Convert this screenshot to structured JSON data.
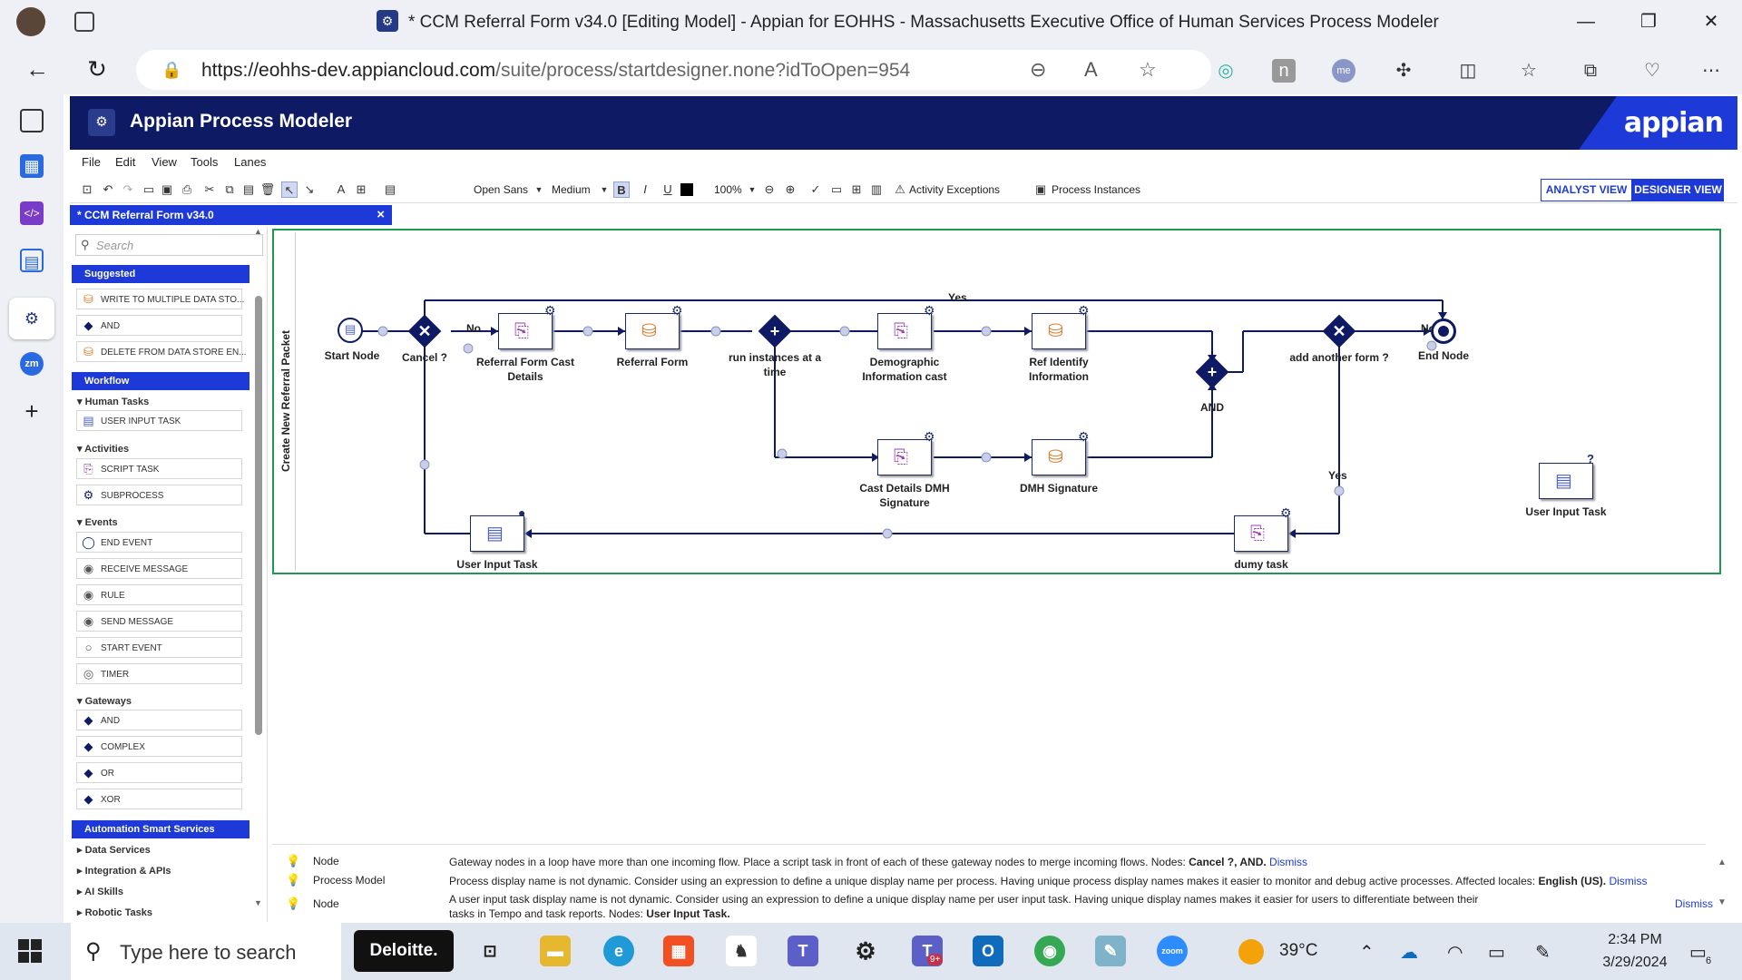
{
  "browser": {
    "window_title": "* CCM Referral Form v34.0 [Editing Model] - Appian for EOHHS - Massachusetts Executive Office of Human Services Process Modeler",
    "url_host": "https://eohhs-dev.appiancloud.com",
    "url_path": "/suite/process/startdesigner.none?idToOpen=954"
  },
  "app": {
    "name": "Appian Process Modeler",
    "brand": "appian"
  },
  "menu": [
    "File",
    "Edit",
    "View",
    "Tools",
    "Lanes"
  ],
  "toolbar": {
    "font": "Open Sans",
    "size": "Medium",
    "zoom": "100%",
    "activity_exceptions": "Activity Exceptions",
    "process_instances": "Process Instances",
    "analyst_view": "ANALYST VIEW",
    "designer_view": "DESIGNER VIEW"
  },
  "tab": {
    "title": "* CCM Referral Form v34.0",
    "close": "×"
  },
  "palette": {
    "search_placeholder": "Search",
    "suggested_title": "Suggested",
    "suggested": [
      "WRITE TO MULTIPLE DATA STO...",
      "AND",
      "DELETE FROM DATA STORE EN..."
    ],
    "workflow_title": "Workflow",
    "human_tasks_title": "Human Tasks",
    "human_tasks": [
      "USER INPUT TASK"
    ],
    "activities_title": "Activities",
    "activities": [
      "SCRIPT TASK",
      "SUBPROCESS"
    ],
    "events_title": "Events",
    "events": [
      "END EVENT",
      "RECEIVE MESSAGE",
      "RULE",
      "SEND MESSAGE",
      "START EVENT",
      "TIMER"
    ],
    "gateways_title": "Gateways",
    "gateways": [
      "AND",
      "COMPLEX",
      "OR",
      "XOR"
    ],
    "automation_title": "Automation Smart Services",
    "automation": [
      "Data Services",
      "Integration & APIs",
      "AI Skills",
      "Robotic Tasks"
    ]
  },
  "diagram": {
    "lane": "Create New Referral Packet",
    "nodes": {
      "start": "Start Node",
      "cancel": "Cancel ?",
      "referral_cast": "Referral Form Cast Details",
      "referral_form": "Referral Form",
      "run_instances": "run instances at a time",
      "demographic": "Demographic Information cast",
      "ref_identify": "Ref Identify Information",
      "and": "AND",
      "add_another": "add another form ?",
      "end": "End Node",
      "cast_dmh": "Cast Details DMH Signature",
      "dmh_signature": "DMH Signature",
      "user_input": "User Input Task",
      "dumy": "dumy task",
      "user_input_2": "User Input Task"
    },
    "flow_labels": {
      "yes_top": "Yes",
      "no_1": "No",
      "no_2": "No",
      "yes_right": "Yes"
    },
    "help_mark": "?"
  },
  "notices": [
    {
      "type": "Node",
      "message": "Gateway nodes in a loop have more than one incoming flow. Place a script task in front of each of these gateway nodes to merge incoming flows. Nodes: ",
      "bold": "Cancel ?, AND.",
      "dismiss": "Dismiss"
    },
    {
      "type": "Process Model",
      "message": "Process display name is not dynamic. Consider using an expression to define a unique display name per process. Having unique process display names makes it easier to monitor and debug active processes. Affected locales: ",
      "bold": "English (US).",
      "dismiss": "Dismiss"
    },
    {
      "type": "Node",
      "message": "A user input task display name is not dynamic. Consider using an expression to define a unique display name per user input task. Having unique display names makes it easier for users to differentiate between their tasks in Tempo and task reports. Nodes: ",
      "bold": "User Input Task.",
      "dismiss": "Dismiss"
    }
  ],
  "taskbar": {
    "search_placeholder": "Type here to search",
    "deloitte": "Deloitte.",
    "weather": "39°C",
    "time": "2:34 PM",
    "date": "3/29/2024",
    "teams_badge": "9+",
    "notif_count": "6"
  },
  "colors": {
    "header": "#0e1a63",
    "accent": "#1d3ad8",
    "lane_border": "#1c9b50"
  }
}
